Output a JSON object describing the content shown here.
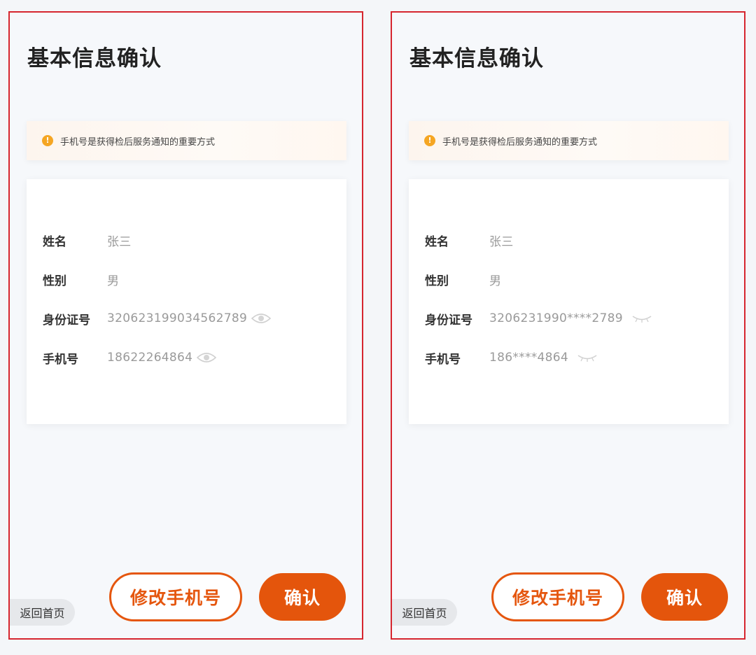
{
  "screens": [
    {
      "title": "基本信息确认",
      "notice": "手机号是获得检后服务通知的重要方式",
      "fields": [
        {
          "label": "姓名",
          "value": "张三"
        },
        {
          "label": "性别",
          "value": "男"
        },
        {
          "label": "身份证号",
          "value": "320623199034562789",
          "icon": "eye-open-icon"
        },
        {
          "label": "手机号",
          "value": "18622264864",
          "icon": "eye-open-icon"
        }
      ],
      "home_label": "返回首页",
      "edit_label": "修改手机号",
      "confirm_label": "确认"
    },
    {
      "title": "基本信息确认",
      "notice": "手机号是获得检后服务通知的重要方式",
      "fields": [
        {
          "label": "姓名",
          "value": "张三"
        },
        {
          "label": "性别",
          "value": "男"
        },
        {
          "label": "身份证号",
          "value": "3206231990****2789",
          "icon": "eye-closed-icon"
        },
        {
          "label": "手机号",
          "value": "186****4864",
          "icon": "eye-closed-icon"
        }
      ],
      "home_label": "返回首页",
      "edit_label": "修改手机号",
      "confirm_label": "确认"
    }
  ],
  "colors": {
    "frame_border": "#d6262f",
    "accent": "#e5560e",
    "warning": "#f5a623"
  }
}
